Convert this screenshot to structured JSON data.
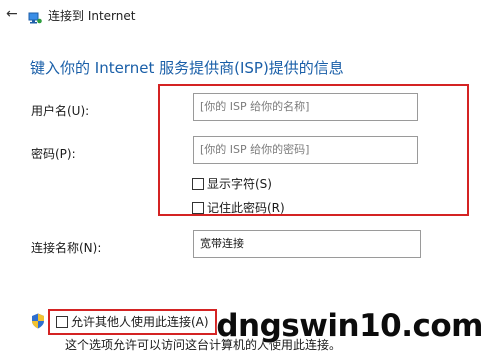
{
  "window": {
    "back_glyph": "←",
    "title": "连接到 Internet",
    "icons": {
      "back": "back-arrow-icon",
      "network": "network-icon"
    }
  },
  "main": {
    "heading": "键入你的 Internet 服务提供商(ISP)提供的信息",
    "username": {
      "label": "用户名(U):",
      "placeholder": "[你的 ISP 给你的名称]"
    },
    "password": {
      "label": "密码(P):",
      "placeholder": "[你的 ISP 给你的密码]"
    },
    "show_chars": {
      "label": "显示字符(S)",
      "checked": false
    },
    "remember_password": {
      "label": "记住此密码(R)",
      "checked": false
    },
    "connection_name": {
      "label": "连接名称(N):",
      "value": "宽带连接"
    },
    "allow_others": {
      "label": "允许其他人使用此连接(A)",
      "checked": false,
      "icon": "shield-icon"
    },
    "description": "这个选项允许可以访问这台计算机的人使用此连接。"
  },
  "watermark": {
    "text": "dngswin10.com"
  },
  "colors": {
    "heading": "#1a5fa8",
    "highlight_box": "#d42323"
  }
}
